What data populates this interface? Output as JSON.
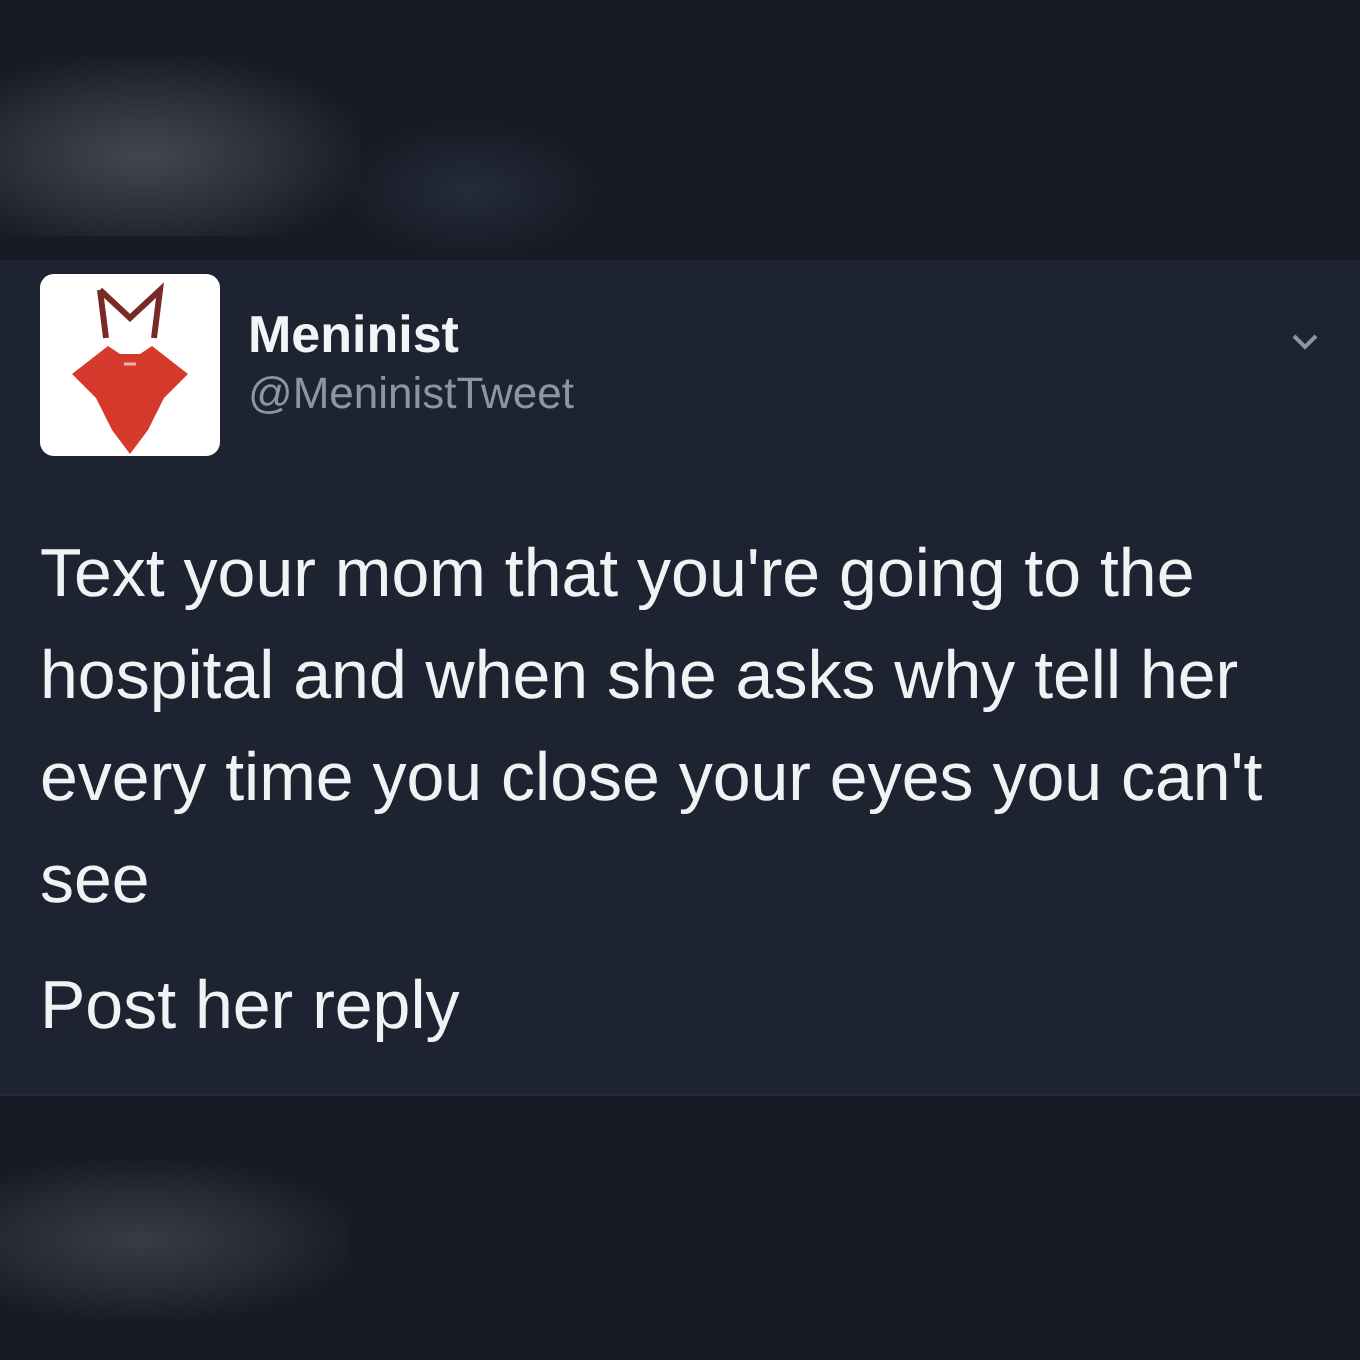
{
  "tweet": {
    "author": {
      "name": "Meninist",
      "handle": "@MeninistTweet"
    },
    "paragraphs": [
      "Text your mom that you're going to the hospital and when she asks why tell her every time you close your eyes you can't see",
      "Post her reply"
    ]
  }
}
